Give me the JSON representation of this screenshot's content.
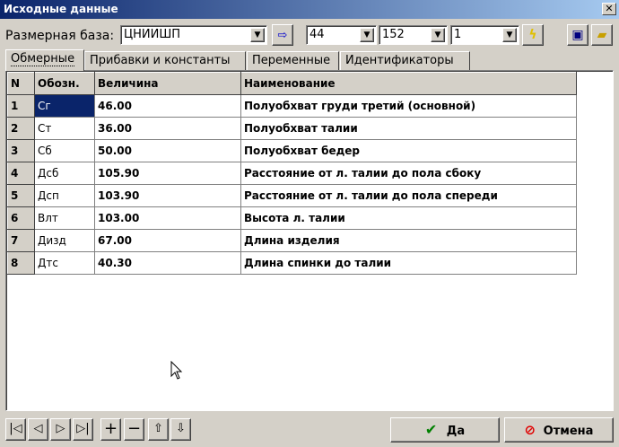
{
  "window": {
    "title": "Исходные данные",
    "close": "✕"
  },
  "toolbar": {
    "base_label": "Размерная база:",
    "base_value": "ЦНИИШП",
    "size1": "44",
    "size2": "152",
    "size3": "1"
  },
  "tabs": [
    {
      "label": "Обмерные"
    },
    {
      "label": "Прибавки и константы"
    },
    {
      "label": "Переменные"
    },
    {
      "label": "Идентификаторы"
    }
  ],
  "table": {
    "headers": [
      "N",
      "Обозн.",
      "Величина",
      "Наименование"
    ],
    "rows": [
      {
        "n": "1",
        "code": "Сг",
        "value": "46.00",
        "name": "Полуобхват груди третий (основной)"
      },
      {
        "n": "2",
        "code": "Ст",
        "value": "36.00",
        "name": "Полуобхват талии"
      },
      {
        "n": "3",
        "code": "Сб",
        "value": "50.00",
        "name": "Полуобхват бедер"
      },
      {
        "n": "4",
        "code": "Дсб",
        "value": "105.90",
        "name": "Расстояние от л. талии до пола сбоку"
      },
      {
        "n": "5",
        "code": "Дсп",
        "value": "103.90",
        "name": "Расстояние от л. талии до пола спереди"
      },
      {
        "n": "6",
        "code": "Влт",
        "value": "103.00",
        "name": "Высота л. талии"
      },
      {
        "n": "7",
        "code": "Дизд",
        "value": "67.00",
        "name": "Длина изделия"
      },
      {
        "n": "8",
        "code": "Дтс",
        "value": "40.30",
        "name": "Длина спинки до талии"
      }
    ]
  },
  "buttons": {
    "ok": "Да",
    "cancel": "Отмена"
  },
  "colors": {
    "title_start": "#0a246a",
    "title_end": "#a6caf0",
    "selection": "#0a246a"
  }
}
